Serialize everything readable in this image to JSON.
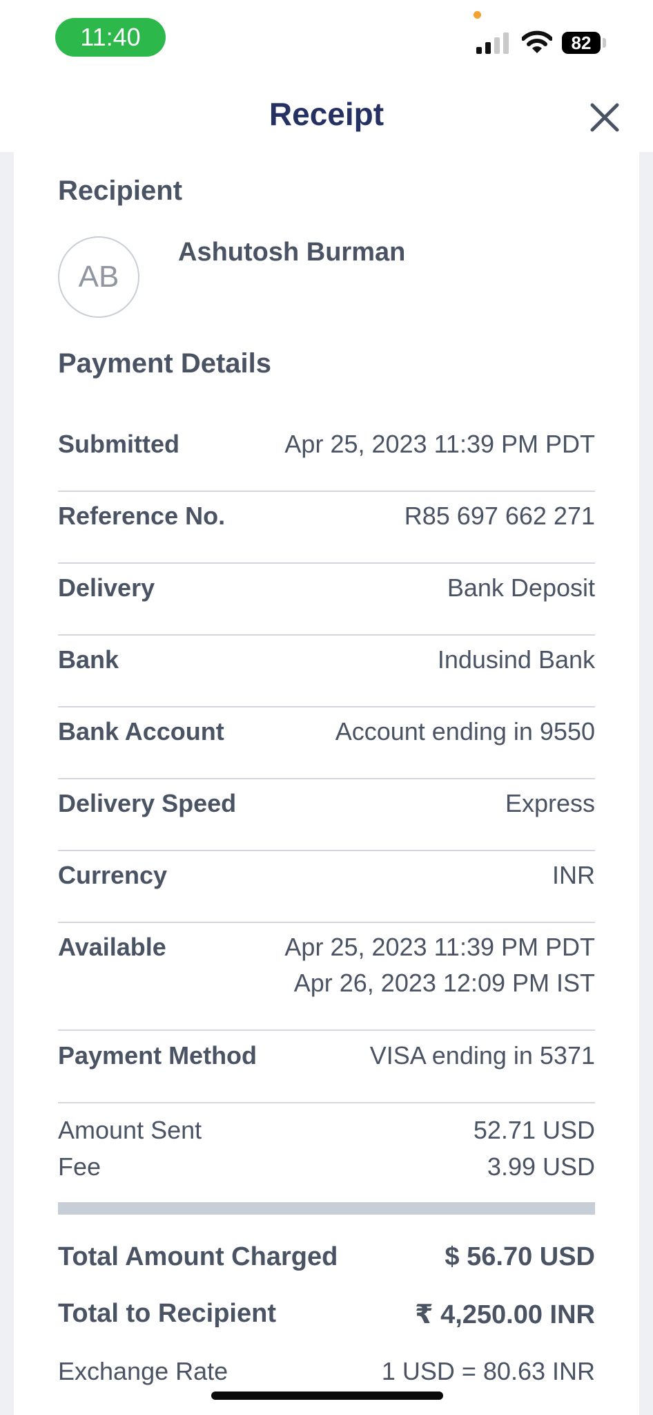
{
  "status_bar": {
    "time": "11:40",
    "battery": "82",
    "time_pill_color": "#2db84c",
    "privacy_dot_color": "#f4a22e"
  },
  "header": {
    "title": "Receipt"
  },
  "recipient": {
    "section_title": "Recipient",
    "initials": "AB",
    "name": "Ashutosh Burman"
  },
  "payment_details": {
    "section_title": "Payment Details",
    "rows": [
      {
        "label": "Submitted",
        "value": "Apr 25, 2023 11:39 PM PDT"
      },
      {
        "label": "Reference No.",
        "value": "R85 697 662 271"
      },
      {
        "label": "Delivery",
        "value": "Bank Deposit"
      },
      {
        "label": "Bank",
        "value": "Indusind Bank"
      },
      {
        "label": "Bank Account",
        "value": "Account ending in 9550"
      },
      {
        "label": "Delivery Speed",
        "value": "Express"
      },
      {
        "label": "Currency",
        "value": "INR"
      },
      {
        "label": "Available",
        "value": "Apr 25, 2023 11:39 PM PDT",
        "value2": "Apr 26, 2023 12:09 PM IST"
      },
      {
        "label": "Payment Method",
        "value": "VISA ending in 5371"
      }
    ]
  },
  "amounts": {
    "amount_sent_label": "Amount Sent",
    "amount_sent_value": "52.71 USD",
    "fee_label": "Fee",
    "fee_value": "3.99 USD"
  },
  "totals": {
    "total_charged_label": "Total Amount Charged",
    "total_charged_value": "$ 56.70 USD",
    "total_recipient_label": "Total to Recipient",
    "total_recipient_value": "₹ 4,250.00 INR",
    "exchange_rate_label": "Exchange Rate",
    "exchange_rate_value": "1 USD = 80.63 INR"
  }
}
